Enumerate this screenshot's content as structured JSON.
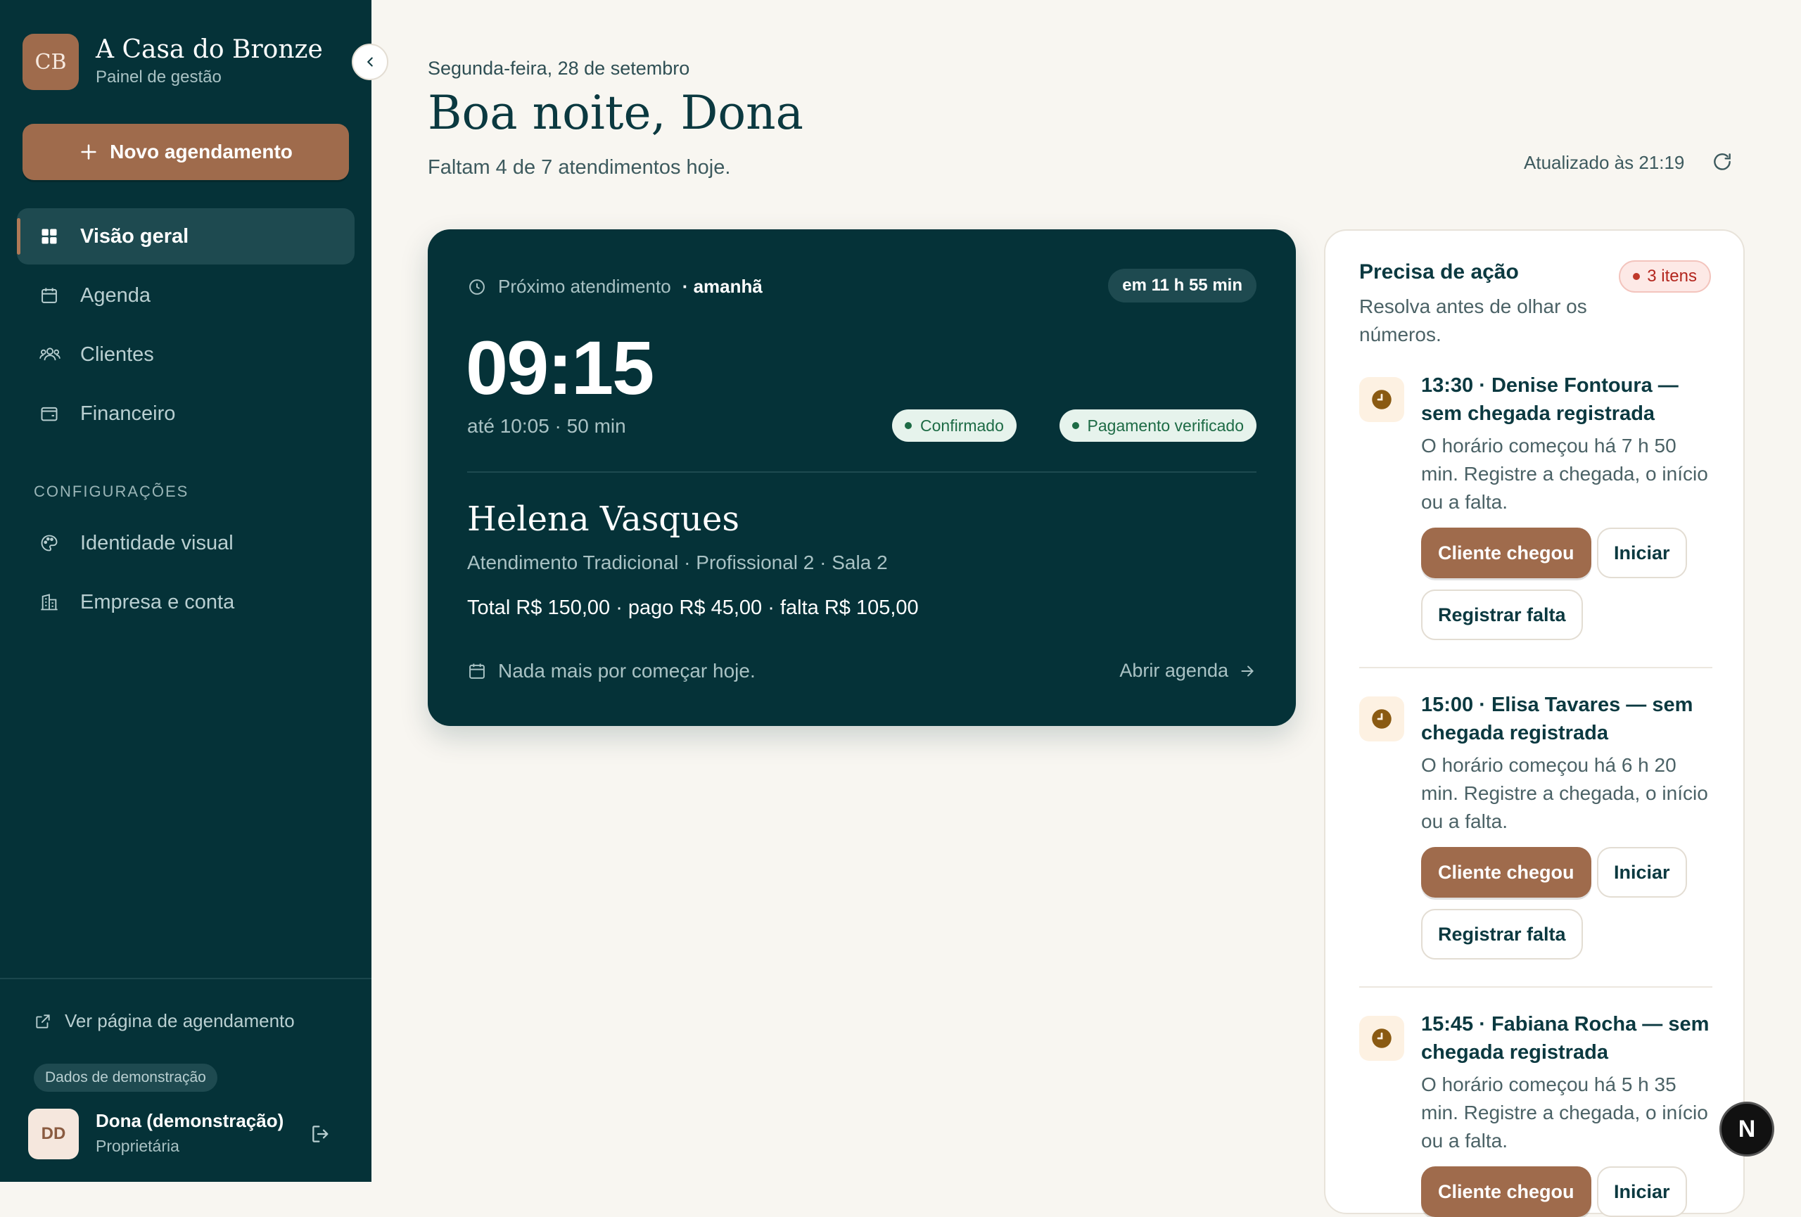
{
  "brand": {
    "initials": "CB",
    "name": "A Casa do Bronze",
    "subtitle": "Painel de gestão"
  },
  "sidebar": {
    "new_button": "Novo agendamento",
    "nav": [
      {
        "label": "Visão geral",
        "icon": "grid-icon",
        "active": true
      },
      {
        "label": "Agenda",
        "icon": "calendar-icon"
      },
      {
        "label": "Clientes",
        "icon": "users-icon"
      },
      {
        "label": "Financeiro",
        "icon": "wallet-icon"
      }
    ],
    "settings_label": "CONFIGURAÇÕES",
    "settings": [
      {
        "label": "Identidade visual",
        "icon": "palette-icon"
      },
      {
        "label": "Empresa e conta",
        "icon": "building-icon"
      }
    ],
    "view_page": "Ver página de agendamento",
    "demo_badge": "Dados de demonstração",
    "user": {
      "initials": "DD",
      "name": "Dona (demonstração)",
      "role": "Proprietária"
    }
  },
  "header": {
    "date": "Segunda-feira, 28 de setembro",
    "greeting": "Boa noite, Dona",
    "remaining": "Faltam 4 de 7 atendimentos hoje.",
    "updated": "Atualizado às 21:19"
  },
  "next": {
    "label": "Próximo atendimento",
    "when": "· amanhã",
    "countdown": "em 11 h 55 min",
    "time": "09:15",
    "until": "até 10:05 · 50 min",
    "status_confirmed": "Confirmado",
    "status_payment": "Pagamento verificado",
    "client": "Helena Vasques",
    "service": "Atendimento Tradicional · Profissional 2 · Sala 2",
    "totals": "Total R$ 150,00 · pago R$ 45,00 · falta R$ 105,00",
    "nothing": "Nada mais por começar hoje.",
    "open_agenda": "Abrir agenda"
  },
  "actions": {
    "title": "Precisa de ação",
    "badge": "3 itens",
    "subtitle": "Resolva antes de olhar os números.",
    "buttons": {
      "arrived": "Cliente chegou",
      "start": "Iniciar",
      "no_show": "Registrar falta"
    },
    "items": [
      {
        "title": "13:30 · Denise Fontoura — sem chegada registrada",
        "desc": "O horário começou há 7 h 50 min. Registre a chegada, o início ou a falta."
      },
      {
        "title": "15:00 · Elisa Tavares — sem chegada registrada",
        "desc": "O horário começou há 6 h 20 min. Registre a chegada, o início ou a falta."
      },
      {
        "title": "15:45 · Fabiana Rocha — sem chegada registrada",
        "desc": "O horário começou há 5 h 35 min. Registre a chegada, o início ou a falta."
      }
    ]
  },
  "floating": {
    "label": "N"
  },
  "colors": {
    "sidebar": "#053238",
    "accent": "#9f6b4c",
    "success": "#1d6b45",
    "alert": "#c0392b",
    "background": "#f8f6f1"
  }
}
